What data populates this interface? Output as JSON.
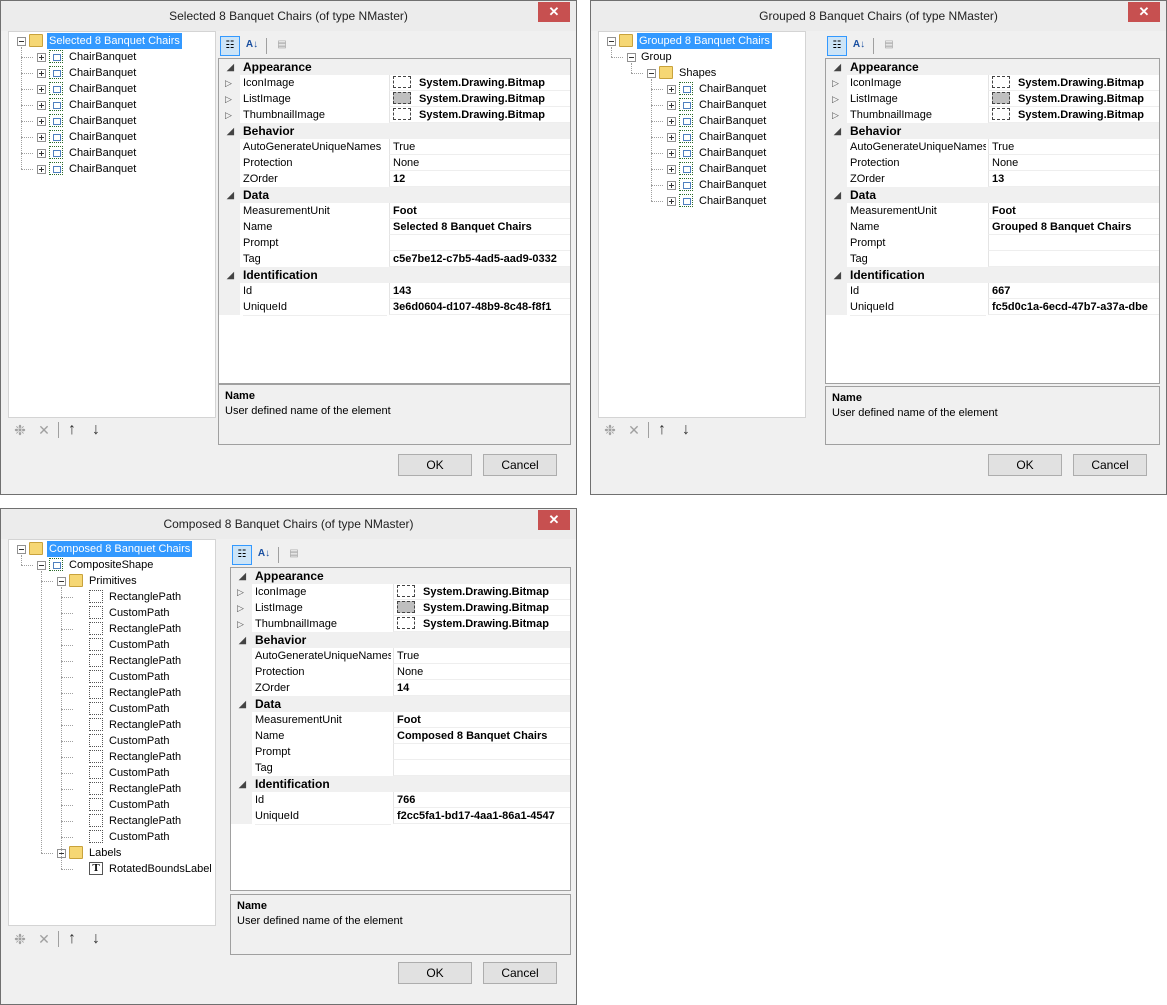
{
  "dialogs": [
    {
      "title": "Selected 8 Banquet Chairs (of type NMaster)",
      "tree": [
        {
          "label": "Selected 8 Banquet Chairs",
          "level": 0,
          "icon": "folder",
          "exp": "minus",
          "selected": true
        },
        {
          "label": "ChairBanquet",
          "level": 1,
          "icon": "chair",
          "exp": "plus"
        },
        {
          "label": "ChairBanquet",
          "level": 1,
          "icon": "chair",
          "exp": "plus"
        },
        {
          "label": "ChairBanquet",
          "level": 1,
          "icon": "chair",
          "exp": "plus"
        },
        {
          "label": "ChairBanquet",
          "level": 1,
          "icon": "chair",
          "exp": "plus"
        },
        {
          "label": "ChairBanquet",
          "level": 1,
          "icon": "chair",
          "exp": "plus"
        },
        {
          "label": "ChairBanquet",
          "level": 1,
          "icon": "chair",
          "exp": "plus"
        },
        {
          "label": "ChairBanquet",
          "level": 1,
          "icon": "chair",
          "exp": "plus"
        },
        {
          "label": "ChairBanquet",
          "level": 1,
          "icon": "chair",
          "exp": "plus"
        }
      ],
      "properties": [
        {
          "type": "cat",
          "name": "Appearance"
        },
        {
          "type": "prop",
          "name": "IconImage",
          "value": "System.Drawing.Bitmap",
          "bitmap": "light",
          "bold": true
        },
        {
          "type": "prop",
          "name": "ListImage",
          "value": "System.Drawing.Bitmap",
          "bitmap": "dark",
          "bold": true
        },
        {
          "type": "prop",
          "name": "ThumbnailImage",
          "value": "System.Drawing.Bitmap",
          "bitmap": "light",
          "bold": true
        },
        {
          "type": "cat",
          "name": "Behavior"
        },
        {
          "type": "prop",
          "name": "AutoGenerateUniqueNames",
          "value": "True"
        },
        {
          "type": "prop",
          "name": "Protection",
          "value": "None"
        },
        {
          "type": "prop",
          "name": "ZOrder",
          "value": "12",
          "bold": true
        },
        {
          "type": "cat",
          "name": "Data"
        },
        {
          "type": "prop",
          "name": "MeasurementUnit",
          "value": "Foot",
          "bold": true
        },
        {
          "type": "prop",
          "name": "Name",
          "value": "Selected 8 Banquet Chairs",
          "bold": true
        },
        {
          "type": "prop",
          "name": "Prompt",
          "value": ""
        },
        {
          "type": "prop",
          "name": "Tag",
          "value": "c5e7be12-c7b5-4ad5-aad9-0332",
          "bold": true
        },
        {
          "type": "cat",
          "name": "Identification"
        },
        {
          "type": "prop",
          "name": "Id",
          "value": "143",
          "bold": true
        },
        {
          "type": "prop",
          "name": "UniqueId",
          "value": "3e6d0604-d107-48b9-8c48-f8f1",
          "bold": true
        }
      ],
      "help_title": "Name",
      "help_text": "User defined name of the element",
      "ok_label": "OK",
      "cancel_label": "Cancel"
    },
    {
      "title": "Grouped 8 Banquet Chairs (of type NMaster)",
      "tree": [
        {
          "label": "Grouped 8 Banquet Chairs",
          "level": 0,
          "icon": "folder",
          "exp": "minus",
          "selected": true
        },
        {
          "label": "Group",
          "level": 1,
          "icon": "none",
          "exp": "minus"
        },
        {
          "label": "Shapes",
          "level": 2,
          "icon": "folder",
          "exp": "minus"
        },
        {
          "label": "ChairBanquet",
          "level": 3,
          "icon": "chair",
          "exp": "plus"
        },
        {
          "label": "ChairBanquet",
          "level": 3,
          "icon": "chair",
          "exp": "plus"
        },
        {
          "label": "ChairBanquet",
          "level": 3,
          "icon": "chair",
          "exp": "plus"
        },
        {
          "label": "ChairBanquet",
          "level": 3,
          "icon": "chair",
          "exp": "plus"
        },
        {
          "label": "ChairBanquet",
          "level": 3,
          "icon": "chair",
          "exp": "plus"
        },
        {
          "label": "ChairBanquet",
          "level": 3,
          "icon": "chair",
          "exp": "plus"
        },
        {
          "label": "ChairBanquet",
          "level": 3,
          "icon": "chair",
          "exp": "plus"
        },
        {
          "label": "ChairBanquet",
          "level": 3,
          "icon": "chair",
          "exp": "plus"
        }
      ],
      "properties": [
        {
          "type": "cat",
          "name": "Appearance"
        },
        {
          "type": "prop",
          "name": "IconImage",
          "value": "System.Drawing.Bitmap",
          "bitmap": "light",
          "bold": true
        },
        {
          "type": "prop",
          "name": "ListImage",
          "value": "System.Drawing.Bitmap",
          "bitmap": "dark",
          "bold": true
        },
        {
          "type": "prop",
          "name": "ThumbnailImage",
          "value": "System.Drawing.Bitmap",
          "bitmap": "light",
          "bold": true
        },
        {
          "type": "cat",
          "name": "Behavior"
        },
        {
          "type": "prop",
          "name": "AutoGenerateUniqueNames",
          "value": "True"
        },
        {
          "type": "prop",
          "name": "Protection",
          "value": "None"
        },
        {
          "type": "prop",
          "name": "ZOrder",
          "value": "13",
          "bold": true
        },
        {
          "type": "cat",
          "name": "Data"
        },
        {
          "type": "prop",
          "name": "MeasurementUnit",
          "value": "Foot",
          "bold": true
        },
        {
          "type": "prop",
          "name": "Name",
          "value": "Grouped 8 Banquet Chairs",
          "bold": true
        },
        {
          "type": "prop",
          "name": "Prompt",
          "value": ""
        },
        {
          "type": "prop",
          "name": "Tag",
          "value": ""
        },
        {
          "type": "cat",
          "name": "Identification"
        },
        {
          "type": "prop",
          "name": "Id",
          "value": "667",
          "bold": true
        },
        {
          "type": "prop",
          "name": "UniqueId",
          "value": "fc5d0c1a-6ecd-47b7-a37a-dbe",
          "bold": true
        }
      ],
      "help_title": "Name",
      "help_text": "User defined name of the element",
      "ok_label": "OK",
      "cancel_label": "Cancel"
    },
    {
      "title": "Composed 8 Banquet Chairs (of type NMaster)",
      "tree": [
        {
          "label": "Composed 8 Banquet Chairs",
          "level": 0,
          "icon": "folder",
          "exp": "minus",
          "selected": true
        },
        {
          "label": "CompositeShape",
          "level": 1,
          "icon": "chair",
          "exp": "minus"
        },
        {
          "label": "Primitives",
          "level": 2,
          "icon": "folder",
          "exp": "minus"
        },
        {
          "label": "RectanglePath",
          "level": 3,
          "icon": "prim",
          "exp": "none"
        },
        {
          "label": "CustomPath",
          "level": 3,
          "icon": "prim",
          "exp": "none"
        },
        {
          "label": "RectanglePath",
          "level": 3,
          "icon": "prim",
          "exp": "none"
        },
        {
          "label": "CustomPath",
          "level": 3,
          "icon": "prim",
          "exp": "none"
        },
        {
          "label": "RectanglePath",
          "level": 3,
          "icon": "prim",
          "exp": "none"
        },
        {
          "label": "CustomPath",
          "level": 3,
          "icon": "prim",
          "exp": "none"
        },
        {
          "label": "RectanglePath",
          "level": 3,
          "icon": "prim",
          "exp": "none"
        },
        {
          "label": "CustomPath",
          "level": 3,
          "icon": "prim",
          "exp": "none"
        },
        {
          "label": "RectanglePath",
          "level": 3,
          "icon": "prim",
          "exp": "none"
        },
        {
          "label": "CustomPath",
          "level": 3,
          "icon": "prim",
          "exp": "none"
        },
        {
          "label": "RectanglePath",
          "level": 3,
          "icon": "prim",
          "exp": "none"
        },
        {
          "label": "CustomPath",
          "level": 3,
          "icon": "prim",
          "exp": "none"
        },
        {
          "label": "RectanglePath",
          "level": 3,
          "icon": "prim",
          "exp": "none"
        },
        {
          "label": "CustomPath",
          "level": 3,
          "icon": "prim",
          "exp": "none"
        },
        {
          "label": "RectanglePath",
          "level": 3,
          "icon": "prim",
          "exp": "none"
        },
        {
          "label": "CustomPath",
          "level": 3,
          "icon": "prim",
          "exp": "none"
        },
        {
          "label": "Labels",
          "level": 2,
          "icon": "folder",
          "exp": "minus"
        },
        {
          "label": "RotatedBoundsLabel",
          "level": 3,
          "icon": "label",
          "exp": "none"
        }
      ],
      "properties": [
        {
          "type": "cat",
          "name": "Appearance"
        },
        {
          "type": "prop",
          "name": "IconImage",
          "value": "System.Drawing.Bitmap",
          "bitmap": "light",
          "bold": true
        },
        {
          "type": "prop",
          "name": "ListImage",
          "value": "System.Drawing.Bitmap",
          "bitmap": "dark",
          "bold": true
        },
        {
          "type": "prop",
          "name": "ThumbnailImage",
          "value": "System.Drawing.Bitmap",
          "bitmap": "light",
          "bold": true
        },
        {
          "type": "cat",
          "name": "Behavior"
        },
        {
          "type": "prop",
          "name": "AutoGenerateUniqueNames",
          "value": "True"
        },
        {
          "type": "prop",
          "name": "Protection",
          "value": "None"
        },
        {
          "type": "prop",
          "name": "ZOrder",
          "value": "14",
          "bold": true
        },
        {
          "type": "cat",
          "name": "Data"
        },
        {
          "type": "prop",
          "name": "MeasurementUnit",
          "value": "Foot",
          "bold": true
        },
        {
          "type": "prop",
          "name": "Name",
          "value": "Composed 8 Banquet Chairs",
          "bold": true
        },
        {
          "type": "prop",
          "name": "Prompt",
          "value": ""
        },
        {
          "type": "prop",
          "name": "Tag",
          "value": ""
        },
        {
          "type": "cat",
          "name": "Identification"
        },
        {
          "type": "prop",
          "name": "Id",
          "value": "766",
          "bold": true
        },
        {
          "type": "prop",
          "name": "UniqueId",
          "value": "f2cc5fa1-bd17-4aa1-86a1-4547",
          "bold": true
        }
      ],
      "help_title": "Name",
      "help_text": "User defined name of the element",
      "ok_label": "OK",
      "cancel_label": "Cancel"
    }
  ],
  "icons": {
    "close": "close-icon",
    "tree_toolbar": [
      "new-item-icon",
      "delete-icon",
      "move-up-icon",
      "move-down-icon"
    ],
    "pg_toolbar": [
      "categorized-icon",
      "alphabetical-icon",
      "property-pages-icon"
    ]
  }
}
